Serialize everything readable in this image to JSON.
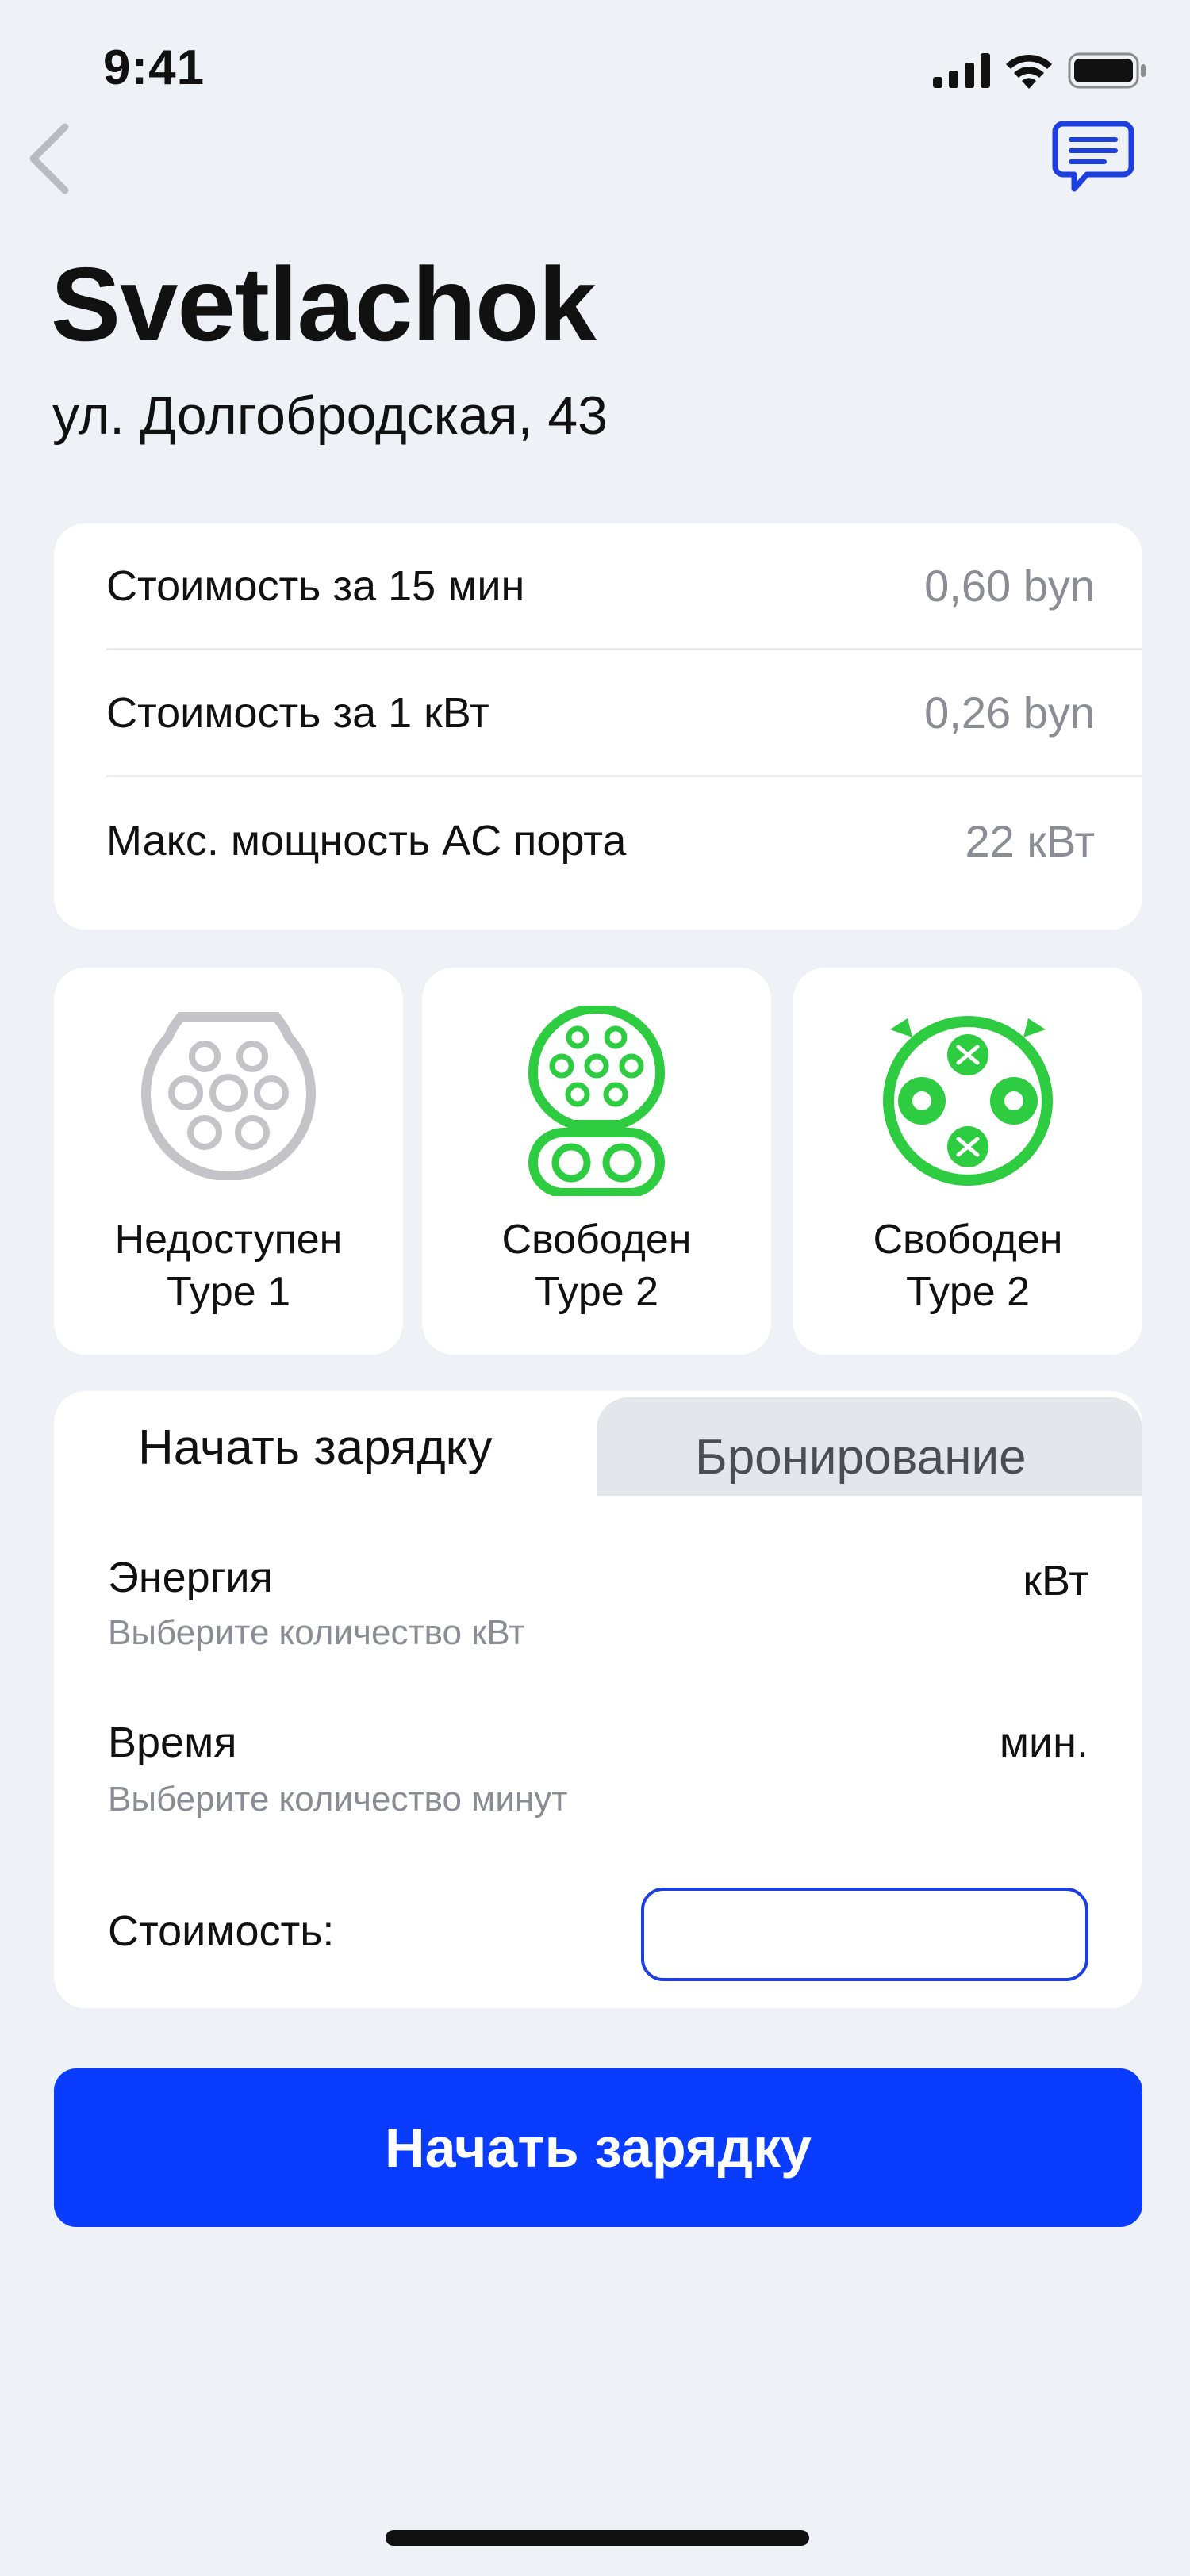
{
  "status_bar": {
    "time": "9:41"
  },
  "header": {
    "title": "Svetlachok",
    "address": "ул. Долгобродская, 43"
  },
  "info": [
    {
      "label": "Стоимость за 15 мин",
      "value": "0,60 byn"
    },
    {
      "label": "Стоимость за 1 кВт",
      "value": "0,26 byn"
    },
    {
      "label": "Макс. мощность AC порта",
      "value": "22 кВт"
    }
  ],
  "connectors": [
    {
      "status": "Недоступен",
      "type": "Type 1",
      "color": "#C4C4C8"
    },
    {
      "status": "Свободен",
      "type": "Type 2",
      "color": "#2ECC40"
    },
    {
      "status": "Свободен",
      "type": "Type 2",
      "color": "#2ECC40"
    }
  ],
  "tabs": {
    "active": "Начать зарядку",
    "inactive": "Бронирование"
  },
  "form": {
    "energy_label": "Энергия",
    "energy_hint": "Выберите количество кВт",
    "energy_unit": "кВт",
    "time_label": "Время",
    "time_hint": "Выберите количество минут",
    "time_unit": "мин.",
    "cost_label": "Стоимость:",
    "cost_value": ""
  },
  "primary_button": {
    "label": "Начать зарядку"
  },
  "colors": {
    "accent": "#0A3CFF",
    "available": "#2ECC40",
    "unavailable": "#C4C4C8",
    "background": "#EEF1F5"
  }
}
